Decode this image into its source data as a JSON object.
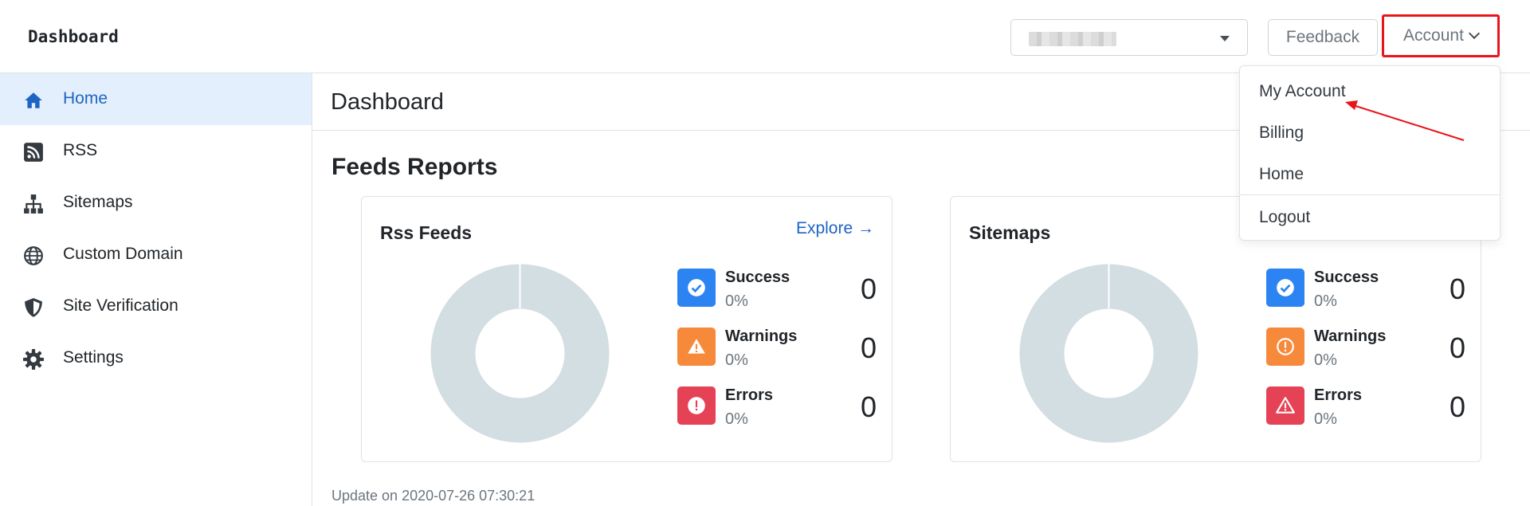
{
  "header": {
    "brand": "Dashboard",
    "feedback_label": "Feedback",
    "account_label": "Account"
  },
  "sidebar": {
    "items": [
      {
        "label": "Home",
        "icon": "home-icon",
        "active": true
      },
      {
        "label": "RSS",
        "icon": "rss-icon",
        "active": false
      },
      {
        "label": "Sitemaps",
        "icon": "sitemap-icon",
        "active": false
      },
      {
        "label": "Custom Domain",
        "icon": "globe-icon",
        "active": false
      },
      {
        "label": "Site Verification",
        "icon": "shield-icon",
        "active": false
      },
      {
        "label": "Settings",
        "icon": "gear-icon",
        "active": false
      }
    ]
  },
  "main": {
    "page_title": "Dashboard",
    "section_title": "Feeds Reports",
    "update_text": "Update on 2020-07-26 07:30:21",
    "cards": [
      {
        "title": "Rss Feeds",
        "explore": "Explore →",
        "stats": [
          {
            "name": "Success",
            "pct": "0%",
            "count": "0",
            "color": "#2b84f1"
          },
          {
            "name": "Warnings",
            "pct": "0%",
            "count": "0",
            "color": "#f7893b"
          },
          {
            "name": "Errors",
            "pct": "0%",
            "count": "0",
            "color": "#e64256"
          }
        ]
      },
      {
        "title": "Sitemaps",
        "stats": [
          {
            "name": "Success",
            "pct": "0%",
            "count": "0",
            "color": "#2b84f1"
          },
          {
            "name": "Warnings",
            "pct": "0%",
            "count": "0",
            "color": "#f7893b"
          },
          {
            "name": "Errors",
            "pct": "0%",
            "count": "0",
            "color": "#e64256"
          }
        ]
      }
    ]
  },
  "account_menu": {
    "items": [
      "My Account",
      "Billing",
      "Home",
      "Logout"
    ]
  },
  "colors": {
    "accent": "#1f64c4",
    "active_bg": "#e3effd",
    "highlight": "#e8151b",
    "donut": "#d3dee2"
  }
}
